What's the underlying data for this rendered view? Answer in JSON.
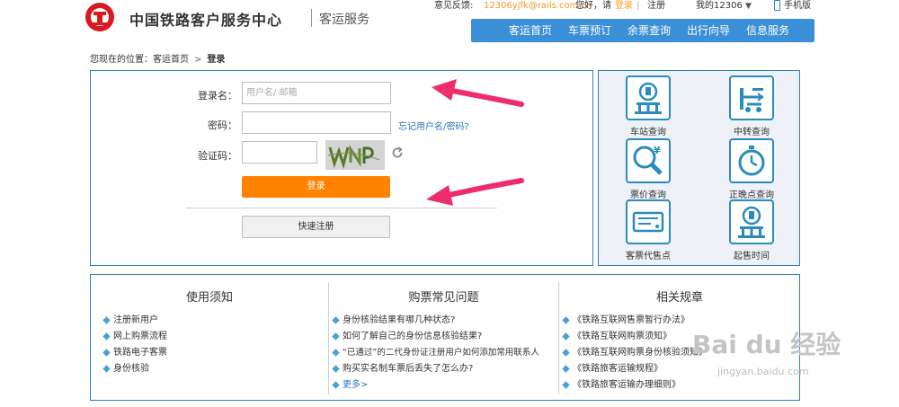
{
  "header": {
    "site_title": "中国铁路客户服务中心",
    "site_sub": "客运服务",
    "feedback_label": "意见反馈:",
    "feedback_email": "12306yjfk@rails.com.cn",
    "greeting": "您好，请",
    "login_link": "登录",
    "divider": "|",
    "register_link": "注册",
    "my_12306": "我的12306",
    "mobile_link": "手机版",
    "nav": [
      "客运首页",
      "车票预订",
      "余票查询",
      "出行向导",
      "信息服务"
    ]
  },
  "breadcrumb": {
    "prefix": "您现在的位置：",
    "home": "客运首页",
    "separator": ">",
    "current": "登录"
  },
  "login_form": {
    "username_label": "登录名：",
    "username_placeholder": "用户名/ 邮箱",
    "password_label": "密码：",
    "forgot_link": "忘记用户名/密码?",
    "captcha_label": "验证码：",
    "captcha_text": "WNP",
    "login_button": "登录",
    "register_button": "快速注册"
  },
  "quick_services": [
    {
      "label": "车站查询",
      "icon": "station-icon"
    },
    {
      "label": "中转查询",
      "icon": "transfer-icon"
    },
    {
      "label": "票价查询",
      "icon": "price-search-icon"
    },
    {
      "label": "正晚点查询",
      "icon": "clock-icon"
    },
    {
      "label": "客票代售点",
      "icon": "ticket-agent-icon"
    },
    {
      "label": "起售时间",
      "icon": "sale-time-icon"
    }
  ],
  "info_columns": [
    {
      "title": "使用须知",
      "items": [
        "注册新用户",
        "网上购票流程",
        "铁路电子客票",
        "身份核验"
      ]
    },
    {
      "title": "购票常见问题",
      "items": [
        "身份核验结果有哪几种状态?",
        "如何了解自己的身份信息核验结果?",
        "“已通过”的二代身份证注册用户如何添加常用联系人",
        "购买实名制车票后丢失了怎么办?"
      ],
      "more": "更多>"
    },
    {
      "title": "相关规章",
      "items": [
        "《铁路互联网售票暂行办法》",
        "《铁路互联网购票须知》",
        "《铁路互联网购票身份核验须知》",
        "《铁路旅客运输规程》",
        "《铁路旅客运输办理细则》"
      ]
    }
  ],
  "watermark": {
    "main": "Bai du 经验",
    "sub": "jingyan.baidu.com"
  },
  "colors": {
    "nav_blue": "#3b8fd6",
    "border_blue": "#2e7fc5",
    "login_orange": "#ff8300",
    "annotation_pink": "#ee2e6b"
  }
}
